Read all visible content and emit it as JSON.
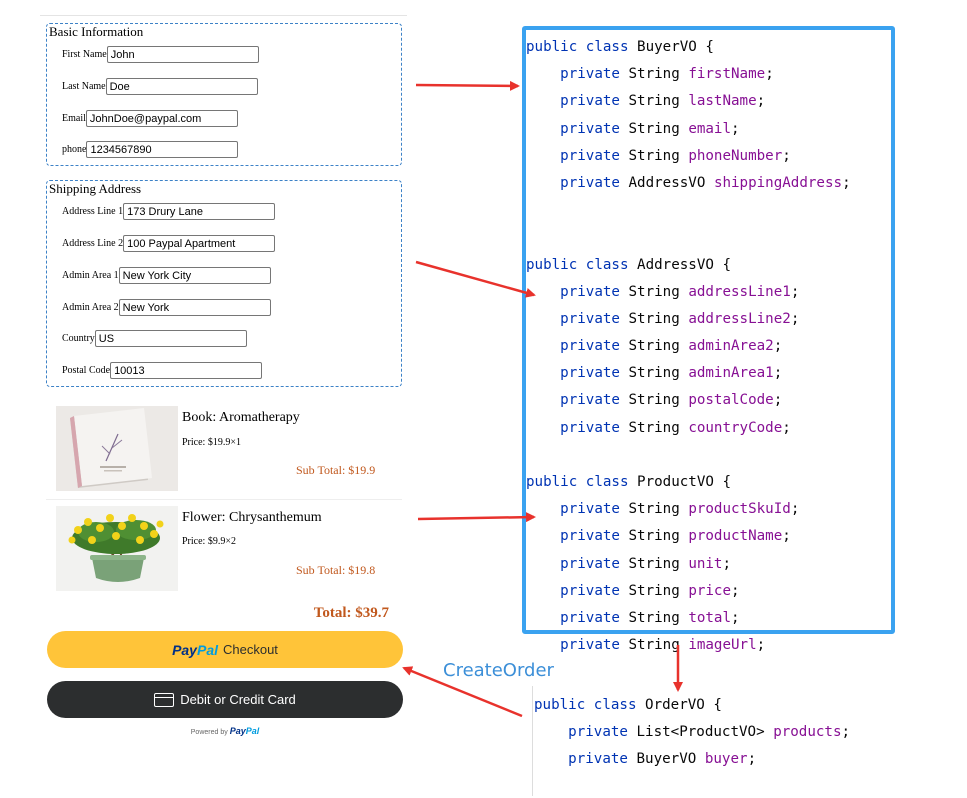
{
  "basic_info": {
    "legend": "Basic Information",
    "fields": [
      {
        "label": "First Name",
        "value": "John"
      },
      {
        "label": "Last Name",
        "value": "Doe"
      },
      {
        "label": "Email",
        "value": "JohnDoe@paypal.com"
      },
      {
        "label": "phone",
        "value": "1234567890"
      }
    ]
  },
  "shipping": {
    "legend": "Shipping Address",
    "fields": [
      {
        "label": "Address Line 1",
        "value": "173 Drury Lane"
      },
      {
        "label": "Address Line 2",
        "value": "100 Paypal Apartment"
      },
      {
        "label": "Admin Area 1",
        "value": "New York City"
      },
      {
        "label": "Admin Area 2",
        "value": "New York"
      },
      {
        "label": "Country",
        "value": "US"
      },
      {
        "label": "Postal Code",
        "value": "10013"
      }
    ]
  },
  "products": [
    {
      "name": "Book: Aromatherapy",
      "price": "Price: $19.9×1",
      "subtotal": "Sub Total: $19.9"
    },
    {
      "name": "Flower: Chrysanthemum",
      "price": "Price: $9.9×2",
      "subtotal": "Sub Total: $19.8"
    }
  ],
  "total": "Total: $39.7",
  "paypal_button": {
    "logo_part1": "Pay",
    "logo_part2": "Pal",
    "label": "Checkout"
  },
  "card_button": {
    "label": "Debit or Credit Card"
  },
  "powered_by": {
    "prefix": "Powered by",
    "logo_part1": "Pay",
    "logo_part2": "Pal"
  },
  "create_order_label": "CreateOrder",
  "code": {
    "buyer": {
      "header": [
        "public class",
        " BuyerVO {"
      ],
      "fields": [
        {
          "type": "String",
          "name": "firstName"
        },
        {
          "type": "String",
          "name": "lastName"
        },
        {
          "type": "String",
          "name": "email"
        },
        {
          "type": "String",
          "name": "phoneNumber"
        },
        {
          "type": "AddressVO",
          "name": "shippingAddress"
        }
      ]
    },
    "address": {
      "header": [
        "public class",
        " AddressVO {"
      ],
      "fields": [
        {
          "type": "String",
          "name": "addressLine1"
        },
        {
          "type": "String",
          "name": "addressLine2"
        },
        {
          "type": "String",
          "name": "adminArea2"
        },
        {
          "type": "String",
          "name": "adminArea1"
        },
        {
          "type": "String",
          "name": "postalCode"
        },
        {
          "type": "String",
          "name": "countryCode"
        }
      ]
    },
    "product": {
      "header": [
        "public class",
        " ProductVO {"
      ],
      "fields": [
        {
          "type": "String",
          "name": "productSkuId"
        },
        {
          "type": "String",
          "name": "productName"
        },
        {
          "type": "String",
          "name": "unit"
        },
        {
          "type": "String",
          "name": "price"
        },
        {
          "type": "String",
          "name": "total"
        },
        {
          "type": "String",
          "name": "imageUrl"
        }
      ]
    },
    "order": {
      "header": [
        "public class",
        " OrderVO {"
      ],
      "fields": [
        {
          "type": "List<ProductVO>",
          "name": "products"
        },
        {
          "type": "BuyerVO",
          "name": "buyer"
        }
      ]
    },
    "keyword_private": "private",
    "semicolon": ";"
  },
  "colors": {
    "keyword": "#0033b3",
    "field": "#871094",
    "arrow": "#e8322c",
    "code_border": "#3aa2f0",
    "paypal_yellow": "#ffc439",
    "card_dark": "#2c2e2f",
    "price_orange": "#c1581d",
    "create_order_blue": "#3c8fd8"
  },
  "icons": [
    "card-icon",
    "book-image",
    "flower-pot-image"
  ]
}
